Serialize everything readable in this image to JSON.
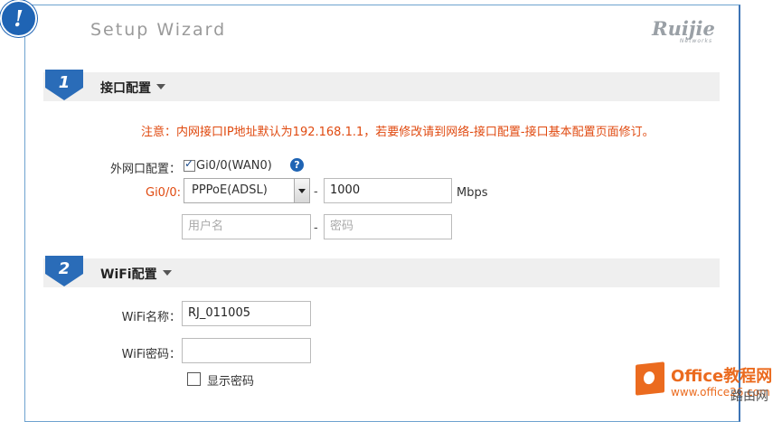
{
  "wizard": {
    "title": "Setup Wizard",
    "logo": "Ruijie",
    "logo_sub": "Networks",
    "badge_glyph": "!"
  },
  "section1": {
    "number": "1",
    "title": "接口配置",
    "notice": "注意：内网接口IP地址默认为192.168.1.1，若要修改请到网络-接口配置-接口基本配置页面修订。",
    "wan_label": "外网口配置：",
    "wan_checkbox_label": "Gi0/0(WAN0)",
    "wan_checked": true,
    "help_glyph": "?",
    "port_label": "Gi0/0:",
    "mode_value": "PPPoE(ADSL)",
    "dash": "-",
    "speed_value": "1000",
    "speed_unit": "Mbps",
    "username_placeholder": "用户名",
    "password_placeholder": "密码"
  },
  "section2": {
    "number": "2",
    "title": "WiFi配置",
    "ssid_label": "WiFi名称：",
    "ssid_value": "RJ_011005",
    "wifi_pw_label": "WiFi密码：",
    "wifi_pw_value": "",
    "show_pw_label": "显示密码",
    "show_pw_checked": false
  },
  "watermark": {
    "brand": "Office教程网",
    "url": "www.office26.com",
    "corner": "路由网"
  },
  "colors": {
    "accent": "#1f64b4",
    "notice": "#e04a10",
    "watermark": "#eb6b1f"
  },
  "icons": {
    "badge": "exclamation-icon",
    "help": "question-icon",
    "dropdown": "caret-down-icon",
    "section_marker": "arrow-down-icon"
  }
}
